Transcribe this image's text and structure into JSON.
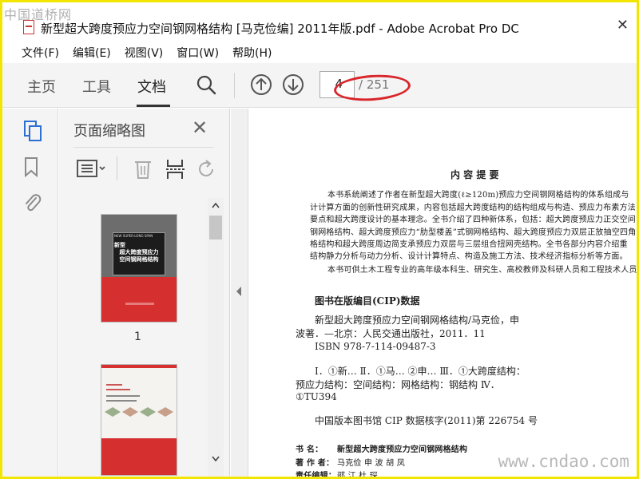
{
  "watermark_top": "中国道桥网",
  "watermark_bottom": "www.cndao.com",
  "window": {
    "title": "新型超大跨度预应力空间钢网格结构 [马克俭编] 2011年版.pdf - Adobe Acrobat Pro DC",
    "close_glyph": "✕"
  },
  "menu": [
    "文件(F)",
    "编辑(E)",
    "视图(V)",
    "窗口(W)",
    "帮助(H)"
  ],
  "toolbar": {
    "tabs": [
      "主页",
      "工具",
      "文档"
    ],
    "active_tab": "文档",
    "page_current": "4",
    "page_total": "/ 251"
  },
  "thumbnail_panel": {
    "title": "页面缩略图",
    "close_glyph": "✕",
    "page1_label": "1",
    "thumb1_cover_title": [
      "新型",
      "超大跨度预应力",
      "空间钢网格结构"
    ],
    "thumb1_cover_banner": "NEW SUPER-LONG SPAN"
  },
  "document": {
    "heading": "内 容 提 要",
    "para1": [
      "本书系统阐述了作者在新型超大跨度(ℓ≥120m)预应力空间钢网格结构的体系组成与",
      "计计算方面的创新性研究成果，内容包括超大跨度结构的结构组成与构造、预应力布素方法",
      "要点和超大跨度设计的基本理念。全书介绍了四种新体系，包括：超大跨度预应力正交空间",
      "钢网格结构、超大跨度预应力“肋型楼盖”式钢网格结构、超大跨度预应力双层正放抽空四角",
      "格结构和超大跨度周边简支承预应力双层与三层组合扭网壳结构。全书各部分内容介绍重",
      "结构静力分析与动力分析、设计计算特点、构造及施工方法、技术经济指标分析等方面。"
    ],
    "para2": "本书可供土木工程专业的高年级本科生、研究生、高校教师及科研人员和工程技术人员参考",
    "cip_title": "图书在版编目(CIP)数据",
    "cip_lines": [
      "新型超大跨度预应力空间钢网格结构/马克俭，申",
      "波著．—北京：人民交通出版社，2011．11",
      "ISBN  978-7-114-09487-3"
    ],
    "class_lines": [
      "Ⅰ．①新…    Ⅱ．①马…  ②申…    Ⅲ．①大跨度结构：",
      "预应力结构：空间结构：网格结构：钢结构    Ⅳ．",
      "①TU394"
    ],
    "cip_number": "中国版本图书馆 CIP 数据核字(2011)第 226754 号",
    "bookname_label": "书      名：",
    "bookname_value": "新型超大跨度预应力空间钢网格结构",
    "authors_label": "著  作  者：",
    "authors_value": "马克俭    申    波    胡    凤",
    "editor_label": "责任编辑：",
    "editor_value": "邵    江    杜    琛"
  },
  "colors": {
    "accent_blue": "#2d6fd4",
    "annotation_red": "#d8262b",
    "frame_yellow": "#f2e600"
  }
}
